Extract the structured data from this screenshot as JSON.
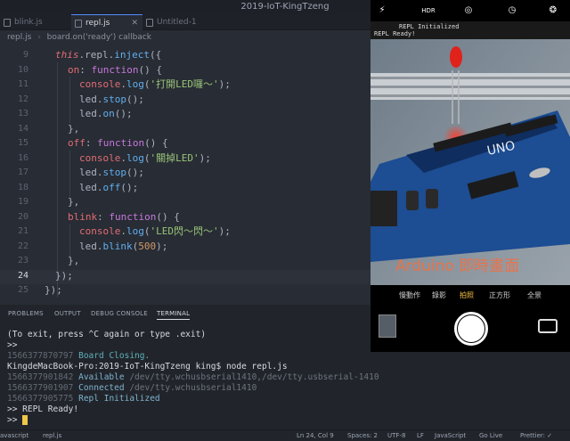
{
  "window": {
    "title": "2019-IoT-KingTzeng"
  },
  "tabs": [
    {
      "label": "blink.js"
    },
    {
      "label": "repl.js"
    },
    {
      "label": "Untitled-1"
    }
  ],
  "breadcrumb": {
    "file": "repl.js",
    "symbol": "board.on('ready') callback"
  },
  "editor": {
    "line_numbers": [
      "9",
      "10",
      "11",
      "12",
      "13",
      "14",
      "15",
      "16",
      "17",
      "18",
      "19",
      "20",
      "21",
      "22",
      "23",
      "24",
      "25"
    ],
    "current_line": "24",
    "code": {
      "l9a": "this",
      "l9b": ".repl.",
      "l9c": "inject",
      "l9d": "({",
      "l10a": "on",
      "l10b": ": ",
      "l10c": "function",
      "l10d": "() {",
      "l11a": "console",
      "l11b": ".",
      "l11c": "log",
      "l11d": "(",
      "l11e": "'打開LED囉～'",
      "l11f": ");",
      "l12a": "led",
      "l12b": ".",
      "l12c": "stop",
      "l12d": "();",
      "l13a": "led",
      "l13b": ".",
      "l13c": "on",
      "l13d": "();",
      "l14": "},",
      "l15a": "off",
      "l15b": ": ",
      "l15c": "function",
      "l15d": "() {",
      "l16a": "console",
      "l16b": ".",
      "l16c": "log",
      "l16d": "(",
      "l16e": "'關掉LED'",
      "l16f": ");",
      "l17a": "led",
      "l17b": ".",
      "l17c": "stop",
      "l17d": "();",
      "l18a": "led",
      "l18b": ".",
      "l18c": "off",
      "l18d": "();",
      "l19": "},",
      "l20a": "blink",
      "l20b": ": ",
      "l20c": "function",
      "l20d": "() {",
      "l21a": "console",
      "l21b": ".",
      "l21c": "log",
      "l21d": "(",
      "l21e": "'LED閃～閃～'",
      "l21f": ");",
      "l22a": "led",
      "l22b": ".",
      "l22c": "blink",
      "l22d": "(",
      "l22e": "500",
      "l22f": ");",
      "l23": "},",
      "l24": "});",
      "l25": "});"
    }
  },
  "phone": {
    "top_overlay_line1": "REPL Initialized",
    "top_overlay_line2": "REPL Ready!",
    "caption": "Arduino 即時畫面",
    "board_label": "UNO",
    "modes": [
      "慢動作",
      "錄影",
      "拍照",
      "正方形",
      "全景"
    ],
    "active_mode": "拍照",
    "hdr_label": "HDR"
  },
  "panel": {
    "tabs": [
      "PROBLEMS",
      "OUTPUT",
      "DEBUG CONSOLE",
      "TERMINAL"
    ],
    "active_tab": "TERMINAL"
  },
  "terminal": {
    "l1": "(To exit, press ^C again or type .exit)",
    "l2": ">>",
    "l3_ts": "1566377870797",
    "l3_msg": "Board",
    "l3_rest": "Closing.",
    "l4": "KingdeMacBook-Pro:2019-IoT-KingTzeng king$ node repl.js",
    "l5_ts": "1566377901842",
    "l5_msg": "Available",
    "l5_rest": "/dev/tty.wchusbserial1410,/dev/tty.usbserial-1410",
    "l6_ts": "1566377901907",
    "l6_msg": "Connected",
    "l6_rest": "/dev/tty.wchusbserial1410",
    "l7_ts": "1566377905775",
    "l7_msg": "Repl",
    "l7_rest": "Initialized",
    "l8": ">> REPL Ready!",
    "l9": ">>"
  },
  "status": {
    "left_file": "repl.js",
    "left_lang_cut": "avascript",
    "position": "Ln 24, Col 9",
    "spaces": "Spaces: 2",
    "encoding": "UTF-8",
    "eol": "LF",
    "language": "JavaScript",
    "golive": "Go Live",
    "prettier": "Prettier: ✓"
  },
  "colors": {
    "editor_bg": "#282c34",
    "accent": "#528bff",
    "keyword": "#c678dd",
    "function": "#61afef",
    "string": "#98c379",
    "number": "#d19a66",
    "caption": "#e8734a",
    "active_mode": "#f6c244"
  }
}
